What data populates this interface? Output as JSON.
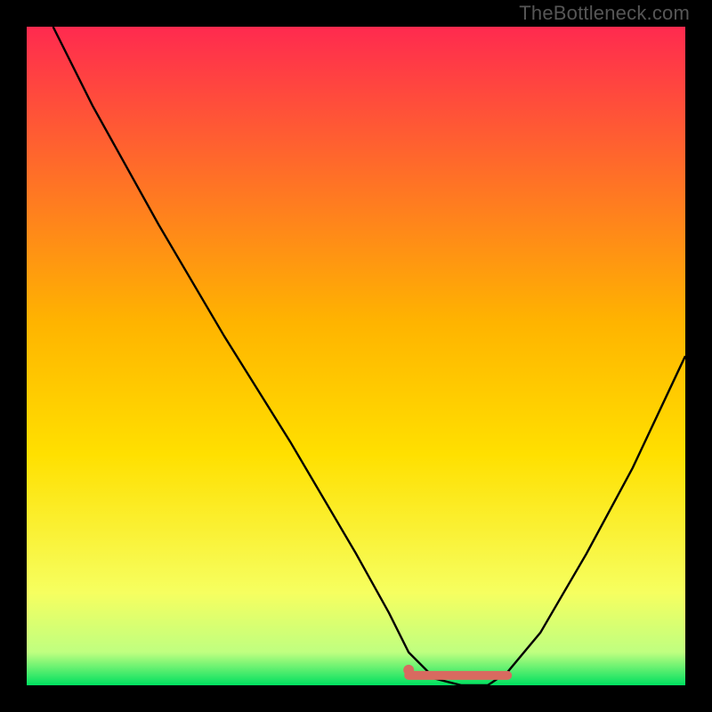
{
  "watermark": "TheBottleneck.com",
  "colors": {
    "background": "#000000",
    "gradient_top": "#ff2a4f",
    "gradient_mid": "#ffd400",
    "gradient_bottom": "#00e060",
    "curve": "#000000",
    "marker": "#d86a60"
  },
  "chart_data": {
    "type": "line",
    "title": "",
    "xlabel": "",
    "ylabel": "",
    "xlim": [
      0,
      100
    ],
    "ylim": [
      0,
      100
    ],
    "series": [
      {
        "name": "bottleneck-curve",
        "x": [
          4,
          10,
          20,
          30,
          40,
          50,
          55,
          58,
          62,
          66,
          70,
          73,
          78,
          85,
          92,
          100
        ],
        "values": [
          100,
          88,
          70,
          53,
          37,
          20,
          11,
          5,
          1,
          0,
          0,
          2,
          8,
          20,
          33,
          50
        ]
      }
    ],
    "annotations": [
      {
        "name": "optimal-range-marker",
        "type": "segment",
        "x": [
          58,
          73
        ],
        "y": [
          1.5,
          1.5
        ],
        "color": "#d86a60"
      }
    ],
    "grid": false,
    "legend": false
  }
}
